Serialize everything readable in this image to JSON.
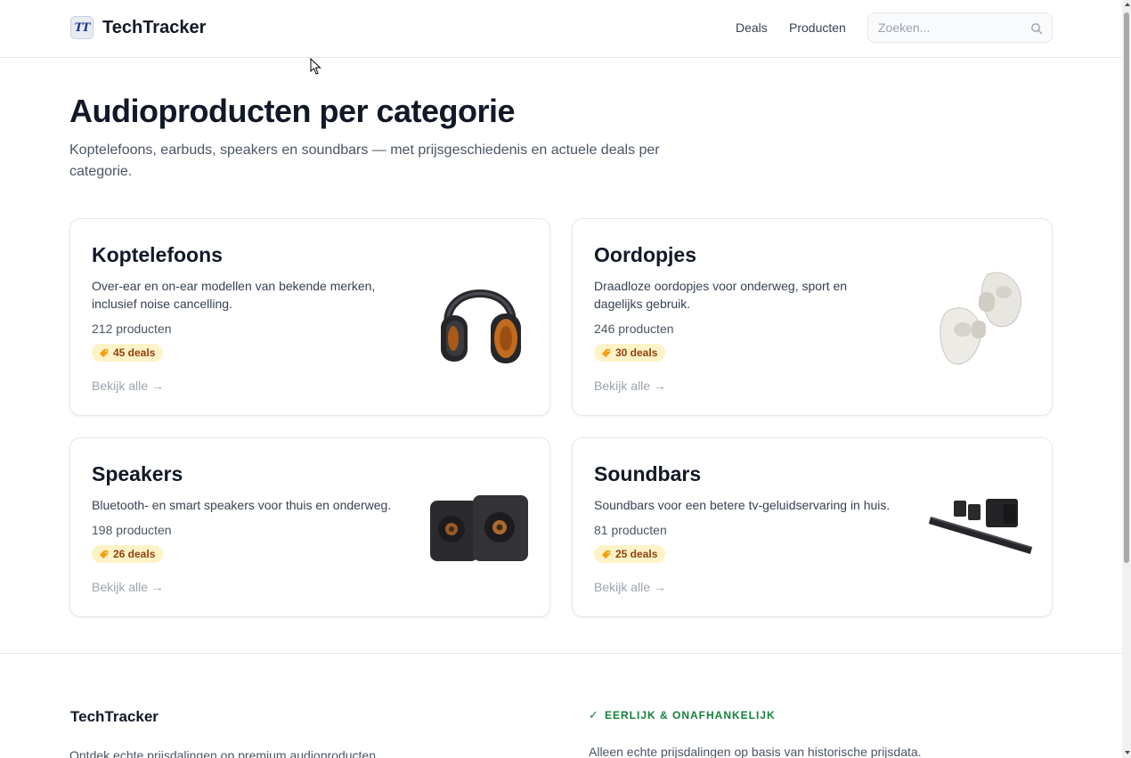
{
  "header": {
    "logo_text": "TT",
    "brand": "TechTracker",
    "nav": {
      "deals": "Deals",
      "products": "Producten"
    },
    "search": {
      "placeholder": "Zoeken...",
      "value": ""
    }
  },
  "hero": {
    "title": "Audioproducten per categorie",
    "subtitle": "Koptelefoons, earbuds, speakers en soundbars — met prijsgeschiedenis en actuele deals per categorie."
  },
  "categories": [
    {
      "title": "Koptelefoons",
      "description": "Over-ear en on-ear modellen van bekende merken, inclusief noise cancelling.",
      "count": "212 producten",
      "deals": "45 deals",
      "link": "Bekijk alle →",
      "image": "over-ear-headphones"
    },
    {
      "title": "Oordopjes",
      "description": "Draadloze oordopjes voor onderweg, sport en dagelijks gebruik.",
      "count": "246 producten",
      "deals": "30 deals",
      "link": "Bekijk alle →",
      "image": "wireless-earbuds"
    },
    {
      "title": "Speakers",
      "description": "Bluetooth- en smart speakers voor thuis en onderweg.",
      "count": "198 producten",
      "deals": "26 deals",
      "link": "Bekijk alle →",
      "image": "bookshelf-speakers"
    },
    {
      "title": "Soundbars",
      "description": "Soundbars voor een betere tv-geluidservaring in huis.",
      "count": "81 producten",
      "deals": "25 deals",
      "link": "Bekijk alle →",
      "image": "soundbar-system"
    }
  ],
  "footer": {
    "brand": "TechTracker",
    "text": "Ontdek echte prijsdalingen op premium audioproducten.",
    "check_icon": "✓",
    "check_label": "EERLIJK & ONAFHANKELIJK",
    "text_2": "Alleen echte prijsdalingen op basis van historische prijsdata."
  },
  "colors": {
    "accent_badge_bg": "#fef3c7",
    "accent_badge_text": "#92400e",
    "footer_green": "#15803d",
    "headphone_cup": "#c26b1e"
  }
}
